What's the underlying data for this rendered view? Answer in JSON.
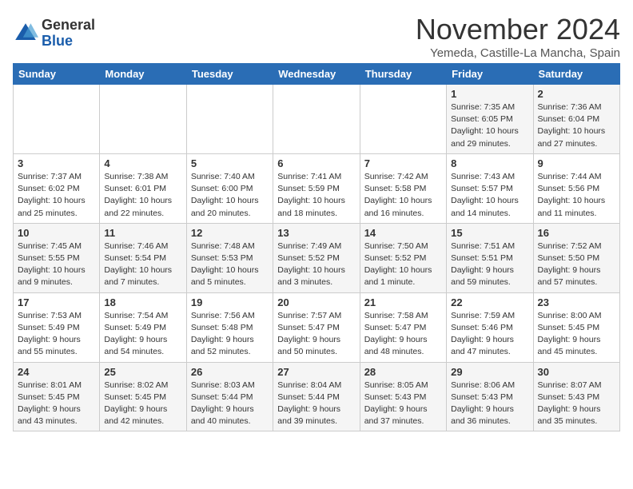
{
  "logo": {
    "general": "General",
    "blue": "Blue"
  },
  "header": {
    "month": "November 2024",
    "location": "Yemeda, Castille-La Mancha, Spain"
  },
  "weekdays": [
    "Sunday",
    "Monday",
    "Tuesday",
    "Wednesday",
    "Thursday",
    "Friday",
    "Saturday"
  ],
  "weeks": [
    [
      {
        "day": "",
        "info": ""
      },
      {
        "day": "",
        "info": ""
      },
      {
        "day": "",
        "info": ""
      },
      {
        "day": "",
        "info": ""
      },
      {
        "day": "",
        "info": ""
      },
      {
        "day": "1",
        "info": "Sunrise: 7:35 AM\nSunset: 6:05 PM\nDaylight: 10 hours\nand 29 minutes."
      },
      {
        "day": "2",
        "info": "Sunrise: 7:36 AM\nSunset: 6:04 PM\nDaylight: 10 hours\nand 27 minutes."
      }
    ],
    [
      {
        "day": "3",
        "info": "Sunrise: 7:37 AM\nSunset: 6:02 PM\nDaylight: 10 hours\nand 25 minutes."
      },
      {
        "day": "4",
        "info": "Sunrise: 7:38 AM\nSunset: 6:01 PM\nDaylight: 10 hours\nand 22 minutes."
      },
      {
        "day": "5",
        "info": "Sunrise: 7:40 AM\nSunset: 6:00 PM\nDaylight: 10 hours\nand 20 minutes."
      },
      {
        "day": "6",
        "info": "Sunrise: 7:41 AM\nSunset: 5:59 PM\nDaylight: 10 hours\nand 18 minutes."
      },
      {
        "day": "7",
        "info": "Sunrise: 7:42 AM\nSunset: 5:58 PM\nDaylight: 10 hours\nand 16 minutes."
      },
      {
        "day": "8",
        "info": "Sunrise: 7:43 AM\nSunset: 5:57 PM\nDaylight: 10 hours\nand 14 minutes."
      },
      {
        "day": "9",
        "info": "Sunrise: 7:44 AM\nSunset: 5:56 PM\nDaylight: 10 hours\nand 11 minutes."
      }
    ],
    [
      {
        "day": "10",
        "info": "Sunrise: 7:45 AM\nSunset: 5:55 PM\nDaylight: 10 hours\nand 9 minutes."
      },
      {
        "day": "11",
        "info": "Sunrise: 7:46 AM\nSunset: 5:54 PM\nDaylight: 10 hours\nand 7 minutes."
      },
      {
        "day": "12",
        "info": "Sunrise: 7:48 AM\nSunset: 5:53 PM\nDaylight: 10 hours\nand 5 minutes."
      },
      {
        "day": "13",
        "info": "Sunrise: 7:49 AM\nSunset: 5:52 PM\nDaylight: 10 hours\nand 3 minutes."
      },
      {
        "day": "14",
        "info": "Sunrise: 7:50 AM\nSunset: 5:52 PM\nDaylight: 10 hours\nand 1 minute."
      },
      {
        "day": "15",
        "info": "Sunrise: 7:51 AM\nSunset: 5:51 PM\nDaylight: 9 hours\nand 59 minutes."
      },
      {
        "day": "16",
        "info": "Sunrise: 7:52 AM\nSunset: 5:50 PM\nDaylight: 9 hours\nand 57 minutes."
      }
    ],
    [
      {
        "day": "17",
        "info": "Sunrise: 7:53 AM\nSunset: 5:49 PM\nDaylight: 9 hours\nand 55 minutes."
      },
      {
        "day": "18",
        "info": "Sunrise: 7:54 AM\nSunset: 5:49 PM\nDaylight: 9 hours\nand 54 minutes."
      },
      {
        "day": "19",
        "info": "Sunrise: 7:56 AM\nSunset: 5:48 PM\nDaylight: 9 hours\nand 52 minutes."
      },
      {
        "day": "20",
        "info": "Sunrise: 7:57 AM\nSunset: 5:47 PM\nDaylight: 9 hours\nand 50 minutes."
      },
      {
        "day": "21",
        "info": "Sunrise: 7:58 AM\nSunset: 5:47 PM\nDaylight: 9 hours\nand 48 minutes."
      },
      {
        "day": "22",
        "info": "Sunrise: 7:59 AM\nSunset: 5:46 PM\nDaylight: 9 hours\nand 47 minutes."
      },
      {
        "day": "23",
        "info": "Sunrise: 8:00 AM\nSunset: 5:45 PM\nDaylight: 9 hours\nand 45 minutes."
      }
    ],
    [
      {
        "day": "24",
        "info": "Sunrise: 8:01 AM\nSunset: 5:45 PM\nDaylight: 9 hours\nand 43 minutes."
      },
      {
        "day": "25",
        "info": "Sunrise: 8:02 AM\nSunset: 5:45 PM\nDaylight: 9 hours\nand 42 minutes."
      },
      {
        "day": "26",
        "info": "Sunrise: 8:03 AM\nSunset: 5:44 PM\nDaylight: 9 hours\nand 40 minutes."
      },
      {
        "day": "27",
        "info": "Sunrise: 8:04 AM\nSunset: 5:44 PM\nDaylight: 9 hours\nand 39 minutes."
      },
      {
        "day": "28",
        "info": "Sunrise: 8:05 AM\nSunset: 5:43 PM\nDaylight: 9 hours\nand 37 minutes."
      },
      {
        "day": "29",
        "info": "Sunrise: 8:06 AM\nSunset: 5:43 PM\nDaylight: 9 hours\nand 36 minutes."
      },
      {
        "day": "30",
        "info": "Sunrise: 8:07 AM\nSunset: 5:43 PM\nDaylight: 9 hours\nand 35 minutes."
      }
    ]
  ]
}
